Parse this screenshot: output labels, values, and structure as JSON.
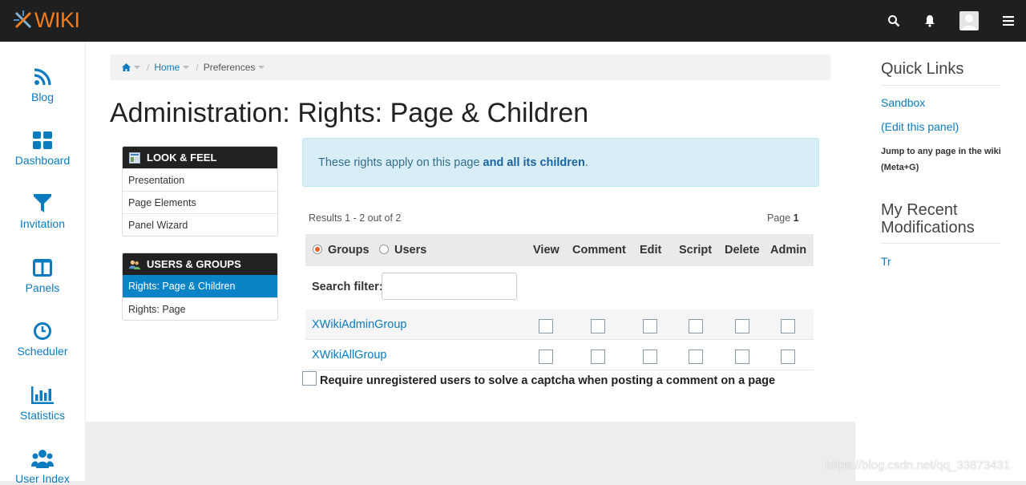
{
  "brand": {
    "logo_text": "WIKI",
    "accent": "#f47c20",
    "link_color": "#0a7bbf"
  },
  "topbar": {
    "search_icon": "search-icon",
    "notifications_icon": "bell-icon",
    "menu_icon": "hamburger-menu-icon"
  },
  "appbar": {
    "items": [
      {
        "label": "Blog",
        "icon": "rss-icon"
      },
      {
        "label": "Dashboard",
        "icon": "grid-icon"
      },
      {
        "label": "Invitation",
        "icon": "filter-icon"
      },
      {
        "label": "Panels",
        "icon": "columns-icon"
      },
      {
        "label": "Scheduler",
        "icon": "clock-icon"
      },
      {
        "label": "Statistics",
        "icon": "bar-chart-icon"
      },
      {
        "label": "User Index",
        "icon": "users-icon"
      }
    ]
  },
  "breadcrumb": {
    "home": "Home",
    "current": "Preferences"
  },
  "page": {
    "title": "Administration: Rights: Page & Children"
  },
  "menus": {
    "look_feel": {
      "heading": "LOOK & FEEL",
      "items": [
        "Presentation",
        "Page Elements",
        "Panel Wizard"
      ]
    },
    "users_groups": {
      "heading": "USERS & GROUPS",
      "items": [
        "Rights: Page & Children",
        "Rights: Page"
      ]
    }
  },
  "info": {
    "prefix": "These rights apply on this page ",
    "emphasis": "and all its children",
    "suffix": "."
  },
  "rights": {
    "results": "Results 1 - 2 out of 2",
    "page_label": "Page ",
    "page_number": "1",
    "groups_label": "Groups",
    "users_label": "Users",
    "columns": [
      "View",
      "Comment",
      "Edit",
      "Script",
      "Delete",
      "Admin"
    ],
    "filter_label": "Search filter:",
    "filter_value": "",
    "rows": [
      "XWikiAdminGroup",
      "XWikiAllGroup"
    ],
    "captcha_label": "Require unregistered users to solve a captcha when posting a comment on a page"
  },
  "rightpanel": {
    "quick_links_title": "Quick Links",
    "sandbox": "Sandbox",
    "edit_panel": "(Edit this panel)",
    "jump_hint": "Jump to any page in the wiki (Meta+G)",
    "recent_title": "My Recent Modifications",
    "recent_item": "Tr"
  },
  "watermark": "https://blog.csdn.net/qq_33873431"
}
